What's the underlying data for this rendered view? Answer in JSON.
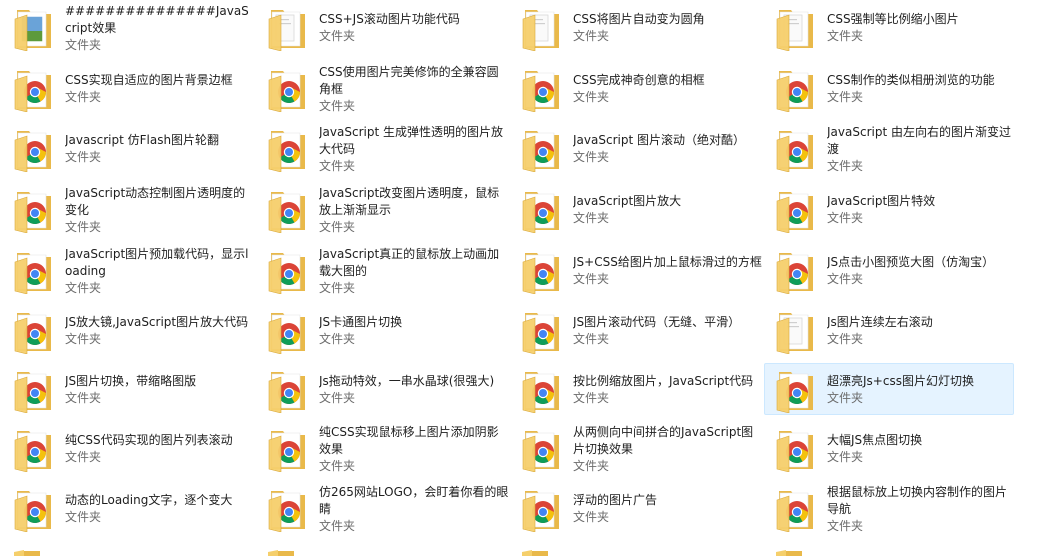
{
  "folder_type": "文件夹",
  "items": [
    {
      "name": "###############JavaScript效果",
      "preview": "photo"
    },
    {
      "name": "CSS+JS滚动图片功能代码",
      "preview": "page"
    },
    {
      "name": "CSS将图片自动变为圆角",
      "preview": "page"
    },
    {
      "name": "CSS强制等比例缩小图片",
      "preview": "page"
    },
    {
      "name": "CSS实现自适应的图片背景边框",
      "preview": "chrome"
    },
    {
      "name": "CSS使用图片完美修饰的全兼容圆角框",
      "preview": "chrome"
    },
    {
      "name": "CSS完成神奇创意的相框",
      "preview": "chrome"
    },
    {
      "name": "CSS制作的类似相册浏览的功能",
      "preview": "chrome"
    },
    {
      "name": "Javascript 仿Flash图片轮翻",
      "preview": "chrome"
    },
    {
      "name": "JavaScript 生成弹性透明的图片放大代码",
      "preview": "chrome"
    },
    {
      "name": "JavaScript 图片滚动（绝对酷）",
      "preview": "chrome"
    },
    {
      "name": "JavaScript 由左向右的图片渐变过渡",
      "preview": "chrome"
    },
    {
      "name": "JavaScript动态控制图片透明度的变化",
      "preview": "chrome"
    },
    {
      "name": "JavaScript改变图片透明度，鼠标放上渐渐显示",
      "preview": "chrome"
    },
    {
      "name": "JavaScript图片放大",
      "preview": "chrome"
    },
    {
      "name": "JavaScript图片特效",
      "preview": "chrome"
    },
    {
      "name": "JavaScript图片预加载代码，显示loading",
      "preview": "chrome"
    },
    {
      "name": "JavaScript真正的鼠标放上动画加载大图的",
      "preview": "chrome"
    },
    {
      "name": "JS+CSS给图片加上鼠标滑过的方框",
      "preview": "chrome"
    },
    {
      "name": "JS点击小图预览大图（仿淘宝）",
      "preview": "chrome"
    },
    {
      "name": "JS放大镜,JavaScript图片放大代码",
      "preview": "chrome"
    },
    {
      "name": "JS卡通图片切换",
      "preview": "chrome"
    },
    {
      "name": "JS图片滚动代码（无缝、平滑）",
      "preview": "chrome"
    },
    {
      "name": "Js图片连续左右滚动",
      "preview": "page"
    },
    {
      "name": "JS图片切换，带缩略图版",
      "preview": "chrome"
    },
    {
      "name": "Js拖动特效，一串水晶球(很强大)",
      "preview": "chrome"
    },
    {
      "name": "按比例缩放图片，JavaScript代码",
      "preview": "chrome"
    },
    {
      "name": "超漂亮Js+css图片幻灯切换",
      "preview": "chrome"
    },
    {
      "name": "纯CSS代码实现的图片列表滚动",
      "preview": "chrome"
    },
    {
      "name": "纯CSS实现鼠标移上图片添加阴影效果",
      "preview": "chrome"
    },
    {
      "name": "从两侧向中间拼合的JavaScript图片切换效果",
      "preview": "chrome"
    },
    {
      "name": "大幅JS焦点图切换",
      "preview": "chrome"
    },
    {
      "name": "动态的Loading文字，逐个变大",
      "preview": "chrome"
    },
    {
      "name": "仿265网站LOGO，会盯着你看的眼睛",
      "preview": "chrome"
    },
    {
      "name": "浮动的图片广告",
      "preview": "chrome"
    },
    {
      "name": "根据鼠标放上切换内容制作的图片导航",
      "preview": "chrome"
    }
  ],
  "selected_index": 27,
  "colors": {
    "folder_body": "#f5cf6b",
    "folder_back": "#e9b94a",
    "selection_bg": "#e5f3ff",
    "selection_border": "#cce8ff",
    "chrome_red": "#db4437",
    "chrome_yellow": "#f4c20d",
    "chrome_green": "#0f9d58",
    "chrome_blue": "#4285f4"
  }
}
